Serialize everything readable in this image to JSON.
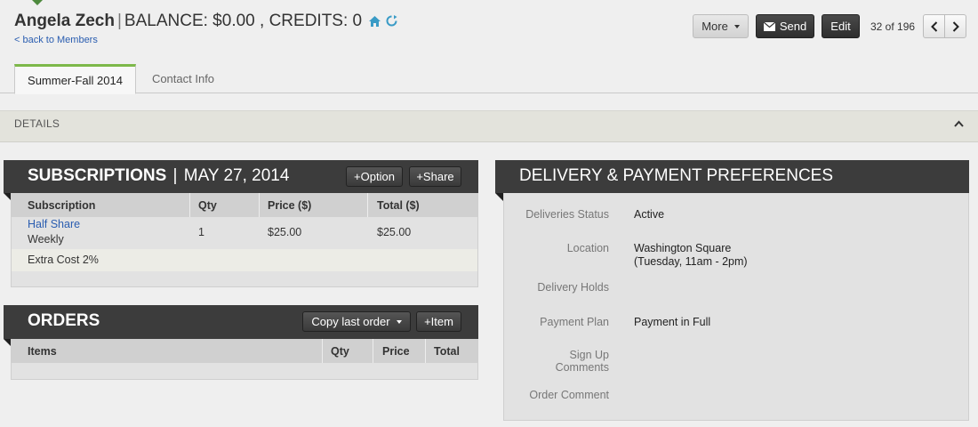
{
  "header": {
    "member_name": "Angela Zech",
    "balance_text": "BALANCE: $0.00",
    "credits_text": ", CREDITS: 0",
    "back_link": "< back to Members"
  },
  "toolbar": {
    "more_label": "More",
    "send_label": "Send",
    "edit_label": "Edit",
    "pager_text": "32 of 196"
  },
  "tabs": [
    {
      "label": "Summer-Fall 2014",
      "active": true
    },
    {
      "label": "Contact Info",
      "active": false
    }
  ],
  "details": {
    "label": "DETAILS"
  },
  "subscriptions": {
    "title": "SUBSCRIPTIONS",
    "date": "MAY 27, 2014",
    "option_button": "+Option",
    "share_button": "+Share",
    "columns": [
      "Subscription",
      "Qty",
      "Price ($)",
      "Total ($)"
    ],
    "rows": [
      {
        "name": "Half Share",
        "frequency": "Weekly",
        "qty": "1",
        "price": "$25.00",
        "total": "$25.00"
      }
    ],
    "extra_cost": "Extra Cost 2%"
  },
  "orders": {
    "title": "ORDERS",
    "copy_button": "Copy last order",
    "item_button": "+Item",
    "columns": [
      "Items",
      "Qty",
      "Price",
      "Total"
    ]
  },
  "preferences": {
    "title": "DELIVERY & PAYMENT PREFERENCES",
    "fields": [
      {
        "label": "Deliveries Status",
        "value": "Active"
      },
      {
        "label": "Location",
        "value": "Washington Square",
        "value2": "(Tuesday, 11am - 2pm)"
      },
      {
        "label": "Delivery Holds",
        "value": ""
      },
      {
        "label": "Payment Plan",
        "value": "Payment in Full"
      },
      {
        "label": "Sign Up",
        "label2": "Comments",
        "value": ""
      },
      {
        "label": "Order Comment",
        "value": ""
      }
    ]
  },
  "colors": {
    "accent_green": "#7db84a",
    "link_blue": "#2a5db0",
    "panel_header": "#3c3c3c",
    "icon_teal": "#3a9bc6"
  },
  "icons": [
    "home-icon",
    "refresh-icon",
    "envelope-icon",
    "chevron-left-icon",
    "chevron-right-icon",
    "chevron-up-icon"
  ]
}
